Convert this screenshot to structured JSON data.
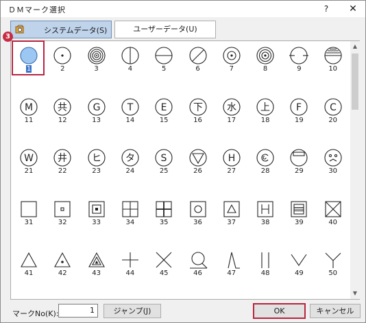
{
  "window": {
    "title": "ＤＭマーク選択",
    "help_glyph": "?",
    "close_glyph": "✕"
  },
  "tabs": [
    {
      "label": "システムデータ(S)",
      "active": true
    },
    {
      "label": "ユーザーデータ(U)",
      "active": false
    }
  ],
  "badge": "3",
  "selected_mark": "1",
  "marks": [
    {
      "no": "1",
      "symbol": "circle-filled-blue",
      "label": ""
    },
    {
      "no": "2",
      "symbol": "circle-dot",
      "label": ""
    },
    {
      "no": "3",
      "symbol": "concentric-circles",
      "label": ""
    },
    {
      "no": "4",
      "symbol": "circle-vertical-line",
      "label": ""
    },
    {
      "no": "5",
      "symbol": "circle-horizontal-line",
      "label": ""
    },
    {
      "no": "6",
      "symbol": "circle-diagonal-line",
      "label": ""
    },
    {
      "no": "7",
      "symbol": "double-circle-dot",
      "label": ""
    },
    {
      "no": "8",
      "symbol": "triple-circle-dot",
      "label": ""
    },
    {
      "no": "9",
      "symbol": "circle-side-ticks",
      "label": ""
    },
    {
      "no": "10",
      "symbol": "circle-hatched-top",
      "label": ""
    },
    {
      "no": "11",
      "symbol": "circle-letter",
      "label": "M"
    },
    {
      "no": "12",
      "symbol": "circle-letter",
      "label": "共"
    },
    {
      "no": "13",
      "symbol": "circle-letter",
      "label": "G"
    },
    {
      "no": "14",
      "symbol": "circle-letter",
      "label": "T"
    },
    {
      "no": "15",
      "symbol": "circle-letter",
      "label": "E"
    },
    {
      "no": "16",
      "symbol": "circle-letter",
      "label": "下"
    },
    {
      "no": "17",
      "symbol": "circle-letter",
      "label": "水"
    },
    {
      "no": "18",
      "symbol": "circle-letter",
      "label": "上"
    },
    {
      "no": "19",
      "symbol": "circle-letter",
      "label": "F"
    },
    {
      "no": "20",
      "symbol": "circle-letter",
      "label": "C"
    },
    {
      "no": "21",
      "symbol": "circle-letter",
      "label": "W"
    },
    {
      "no": "22",
      "symbol": "circle-letter",
      "label": "井"
    },
    {
      "no": "23",
      "symbol": "circle-letter",
      "label": "ヒ"
    },
    {
      "no": "24",
      "symbol": "circle-letter",
      "label": "タ"
    },
    {
      "no": "25",
      "symbol": "circle-letter",
      "label": "S"
    },
    {
      "no": "26",
      "symbol": "circle-triangle-down",
      "label": ""
    },
    {
      "no": "27",
      "symbol": "circle-letter",
      "label": "H"
    },
    {
      "no": "28",
      "symbol": "circle-spiral",
      "label": ""
    },
    {
      "no": "29",
      "symbol": "circle-bar",
      "label": ""
    },
    {
      "no": "30",
      "symbol": "circle-face",
      "label": ""
    },
    {
      "no": "31",
      "symbol": "square",
      "label": ""
    },
    {
      "no": "32",
      "symbol": "square-dot",
      "label": ""
    },
    {
      "no": "33",
      "symbol": "square-nested",
      "label": ""
    },
    {
      "no": "34",
      "symbol": "square-cross",
      "label": ""
    },
    {
      "no": "35",
      "symbol": "square-cross-thick",
      "label": ""
    },
    {
      "no": "36",
      "symbol": "square-circle",
      "label": ""
    },
    {
      "no": "37",
      "symbol": "square-triangle",
      "label": ""
    },
    {
      "no": "38",
      "symbol": "square-letter",
      "label": "H"
    },
    {
      "no": "39",
      "symbol": "square-lines",
      "label": ""
    },
    {
      "no": "40",
      "symbol": "square-x",
      "label": ""
    },
    {
      "no": "41",
      "symbol": "triangle",
      "label": ""
    },
    {
      "no": "42",
      "symbol": "triangle-dot",
      "label": ""
    },
    {
      "no": "43",
      "symbol": "triangle-nested",
      "label": ""
    },
    {
      "no": "44",
      "symbol": "plus",
      "label": ""
    },
    {
      "no": "45",
      "symbol": "x-cross",
      "label": ""
    },
    {
      "no": "46",
      "symbol": "circle-tail",
      "label": ""
    },
    {
      "no": "47",
      "symbol": "lambda-mark",
      "label": ""
    },
    {
      "no": "48",
      "symbol": "double-vertical-line",
      "label": ""
    },
    {
      "no": "49",
      "symbol": "v-mark",
      "label": ""
    },
    {
      "no": "50",
      "symbol": "y-mark",
      "label": ""
    }
  ],
  "footer": {
    "markno_label": "マークNo(K):",
    "markno_value": "1",
    "jump_label": "ジャンプ(J)",
    "ok_label": "OK",
    "cancel_label": "キャンセル"
  },
  "colors": {
    "accent": "#b8243f",
    "selection": "#3a73c9",
    "tab_active": "#bfd3ea",
    "symbol_fill": "#9cc7f2"
  }
}
